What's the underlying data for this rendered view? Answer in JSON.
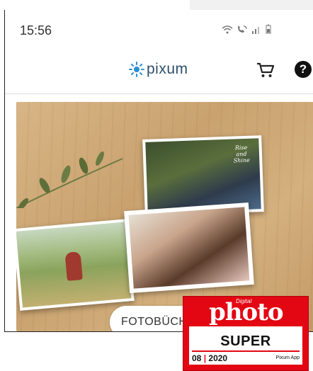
{
  "status_bar": {
    "time": "15:56",
    "icons": [
      "wifi-icon",
      "call-icon",
      "signal-icon",
      "battery-icon"
    ]
  },
  "app_bar": {
    "logo_text": "pixum",
    "icons": [
      "cart-icon",
      "help-icon"
    ],
    "help_glyph": "?"
  },
  "hero": {
    "handwriting": "Rise and Shine",
    "cta_label": "FOTOBÜCH"
  },
  "badge": {
    "kicker": "Digital",
    "brand": "photo",
    "rating": "SUPER",
    "issue": "08",
    "year": "2020",
    "category": "Pixum App"
  },
  "colors": {
    "brand_blue": "#2a8fd0",
    "badge_red": "#e30613"
  }
}
